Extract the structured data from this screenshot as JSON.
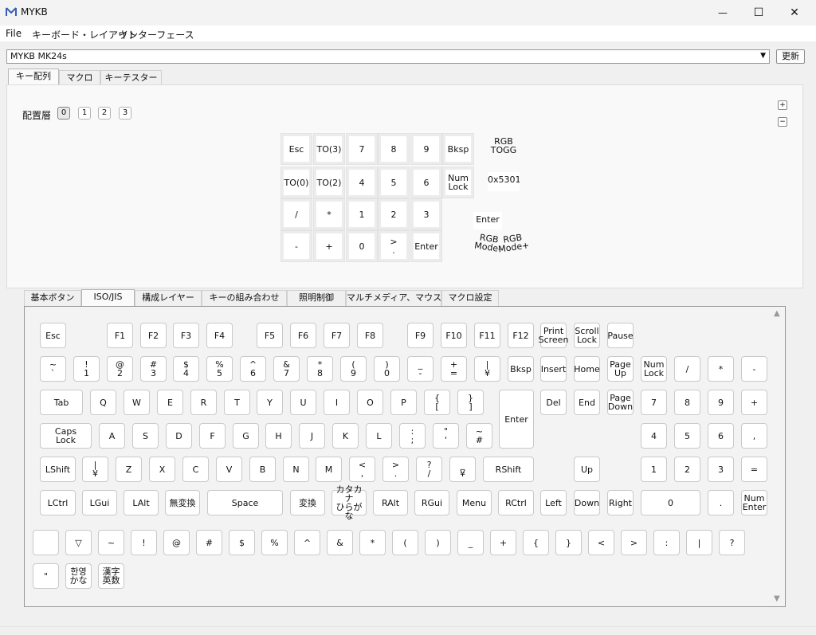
{
  "window": {
    "title": "MYKB",
    "minimize": "—",
    "maximize": "☐",
    "close": "✕"
  },
  "menu": [
    "File",
    "キーボード・レイアウト",
    "インターフェース"
  ],
  "device": {
    "selected": "MYKB MK24s",
    "refresh_label": "更新"
  },
  "main_tabs": [
    "キー配列",
    "マクロ",
    "キーテスター"
  ],
  "layer": {
    "label": "配置層",
    "buttons": [
      "0",
      "1",
      "2",
      "3"
    ],
    "active": 0
  },
  "zoom": {
    "plus": "+",
    "minus": "−"
  },
  "matrix_keys": [
    [
      "Esc",
      "TO(3)",
      "7",
      "8",
      "9",
      "Bksp"
    ],
    [
      "TO(0)",
      "TO(2)",
      "4",
      "5",
      "6",
      "Num\nLock"
    ],
    [
      "/",
      "*",
      "1",
      "2",
      "3"
    ],
    [
      "-",
      "+",
      "0",
      ">\n.",
      "Enter"
    ]
  ],
  "extra_keys": {
    "rgb_togg": "RGB\nTOGG",
    "hex_code": "0x5301",
    "enter": "Enter",
    "rgb_mode_minus": "RGB\nMode-",
    "rgb_mode_plus": "RGB\nMode+"
  },
  "lower_tabs": [
    "基本ボタン",
    "ISO/JIS",
    "構成レイヤー",
    "キーの組み合わせ",
    "照明制御",
    "マルチメディア、マウス",
    "マクロ設定"
  ],
  "lower_active_tab": 1,
  "iso_rows": {
    "row0": [
      "Esc",
      "F1",
      "F2",
      "F3",
      "F4",
      "F5",
      "F6",
      "F7",
      "F8",
      "F9",
      "F10",
      "F11",
      "F12",
      "Print\nScreen",
      "Scroll\nLock",
      "Pause"
    ],
    "row1": [
      "~\n`",
      "!\n1",
      "@\n2",
      "#\n3",
      "$\n4",
      "%\n5",
      "^\n6",
      "&\n7",
      "*\n8",
      "(\n9",
      ")\n0",
      "_\n-",
      "+\n=",
      "|\n¥",
      "Bksp",
      "Insert",
      "Home",
      "Page\nUp",
      "Num\nLock",
      "/",
      "*",
      "-"
    ],
    "row2": [
      "Tab",
      "Q",
      "W",
      "E",
      "R",
      "T",
      "Y",
      "U",
      "I",
      "O",
      "P",
      "{\n[",
      "}\n]",
      "Enter",
      "Del",
      "End",
      "Page\nDown",
      "7",
      "8",
      "9",
      "+"
    ],
    "row3": [
      "Caps\nLock",
      "A",
      "S",
      "D",
      "F",
      "G",
      "H",
      "J",
      "K",
      "L",
      ":\n;",
      "\"\n'",
      "~\n#",
      "4",
      "5",
      "6",
      ","
    ],
    "row4": [
      "LShift",
      "|\n¥",
      "Z",
      "X",
      "C",
      "V",
      "B",
      "N",
      "M",
      "<\n,",
      ">\n.",
      "?\n/",
      "_\n¥",
      "RShift",
      "Up",
      "1",
      "2",
      "3",
      "="
    ],
    "row5": [
      "LCtrl",
      "LGui",
      "LAlt",
      "無変換",
      "Space",
      "変換",
      "カタカナ\nひらがな",
      "RAlt",
      "RGui",
      "Menu",
      "RCtrl",
      "Left",
      "Down",
      "Right",
      "0",
      ".",
      "Num\nEnter"
    ],
    "row6": [
      "",
      "▽",
      "~",
      "!",
      "@",
      "#",
      "$",
      "%",
      "^",
      "&",
      "*",
      "(",
      ")",
      "_",
      "+",
      "{",
      "}",
      "<",
      ">",
      ":",
      "|",
      "?"
    ],
    "row7": [
      "\"",
      "한영\nかな",
      "漢字\n英数"
    ]
  },
  "scroll": {
    "up": "▲",
    "down": "▼"
  }
}
